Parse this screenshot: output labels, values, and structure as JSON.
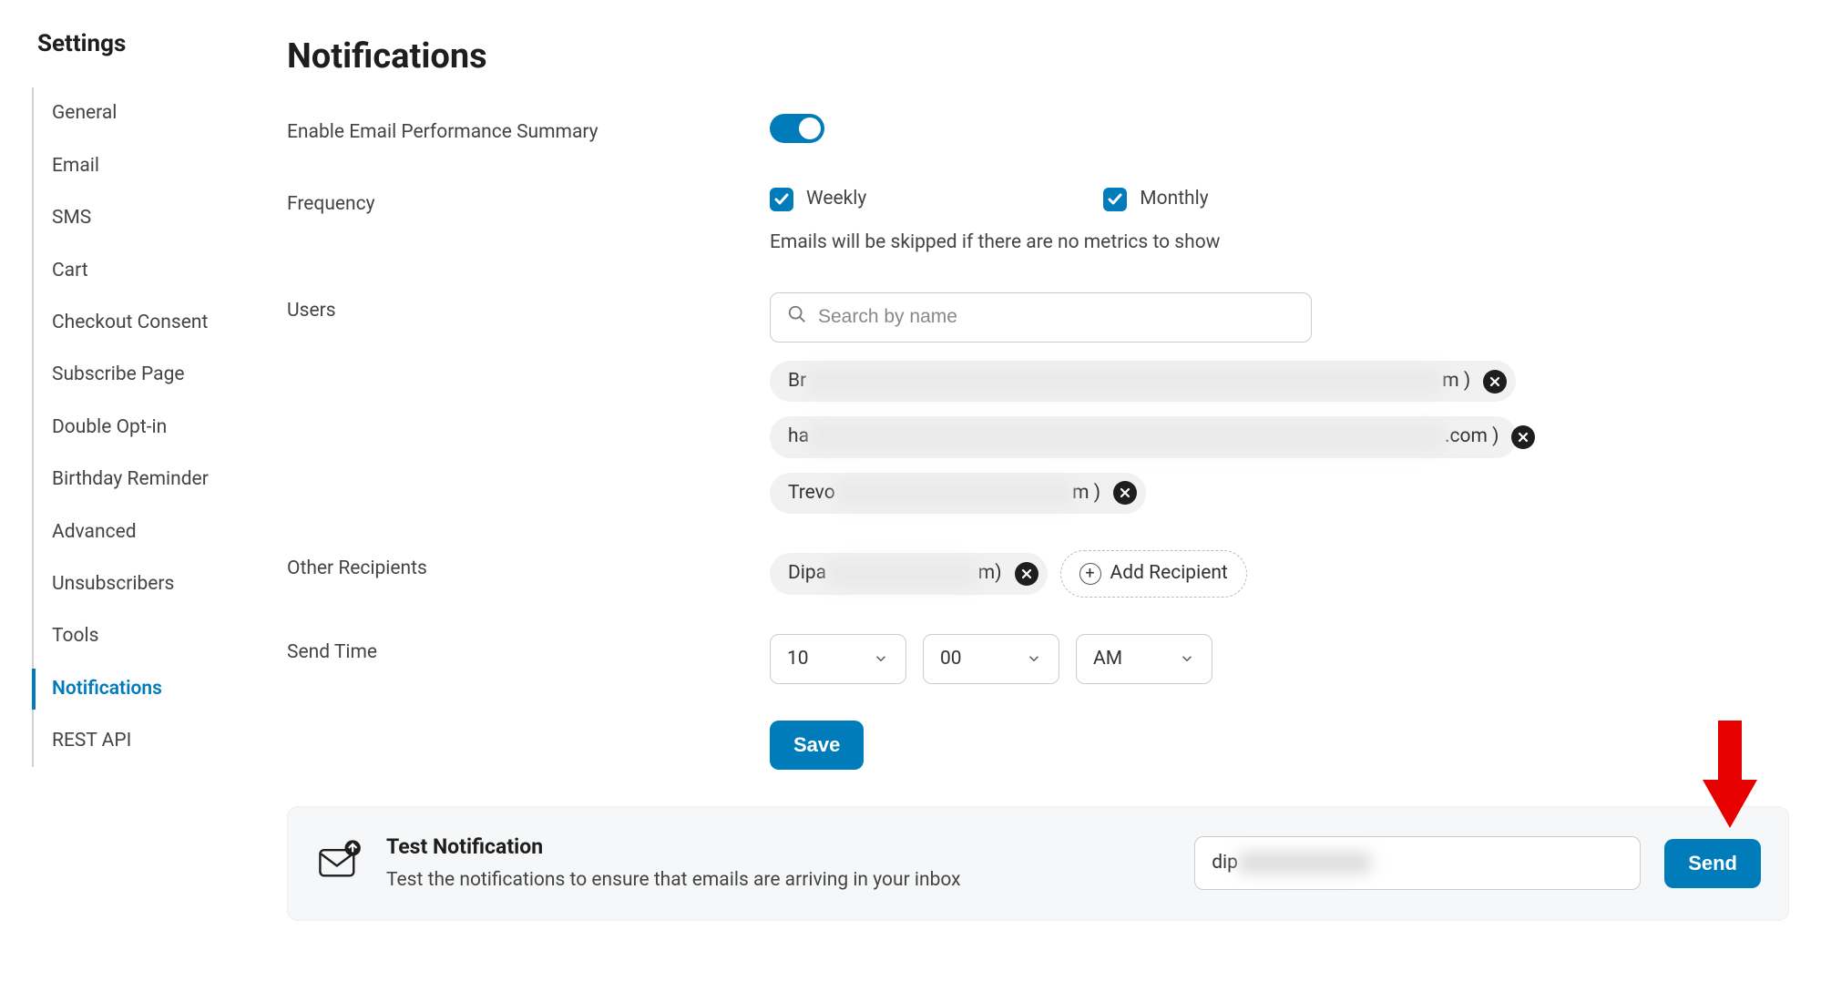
{
  "sidebar": {
    "title": "Settings",
    "items": [
      {
        "label": "General"
      },
      {
        "label": "Email"
      },
      {
        "label": "SMS"
      },
      {
        "label": "Cart"
      },
      {
        "label": "Checkout Consent"
      },
      {
        "label": "Subscribe Page"
      },
      {
        "label": "Double Opt-in"
      },
      {
        "label": "Birthday Reminder"
      },
      {
        "label": "Advanced"
      },
      {
        "label": "Unsubscribers"
      },
      {
        "label": "Tools"
      },
      {
        "label": "Notifications",
        "active": true
      },
      {
        "label": "REST API"
      }
    ]
  },
  "page": {
    "title": "Notifications"
  },
  "form": {
    "enable": {
      "label": "Enable Email Performance Summary",
      "on": true
    },
    "frequency": {
      "label": "Frequency",
      "options": {
        "weekly": "Weekly",
        "monthly": "Monthly"
      },
      "helper": "Emails will be skipped if there are no metrics to show"
    },
    "users": {
      "label": "Users",
      "search_placeholder": "Search by name",
      "pills": [
        {
          "prefix": "Br",
          "suffix": "m )"
        },
        {
          "prefix": "ha",
          "suffix": ".com )"
        },
        {
          "prefix": "Trevo",
          "suffix": "m )"
        }
      ]
    },
    "other_recipients": {
      "label": "Other Recipients",
      "pills": [
        {
          "prefix": "Dipa",
          "suffix": "m)"
        }
      ],
      "add_label": "Add Recipient"
    },
    "send_time": {
      "label": "Send Time",
      "hour": "10",
      "minute": "00",
      "ampm": "AM"
    },
    "save_label": "Save"
  },
  "test_panel": {
    "title": "Test Notification",
    "description": "Test the notifications to ensure that emails are arriving in your inbox",
    "input_prefix": "dip",
    "send_label": "Send"
  }
}
